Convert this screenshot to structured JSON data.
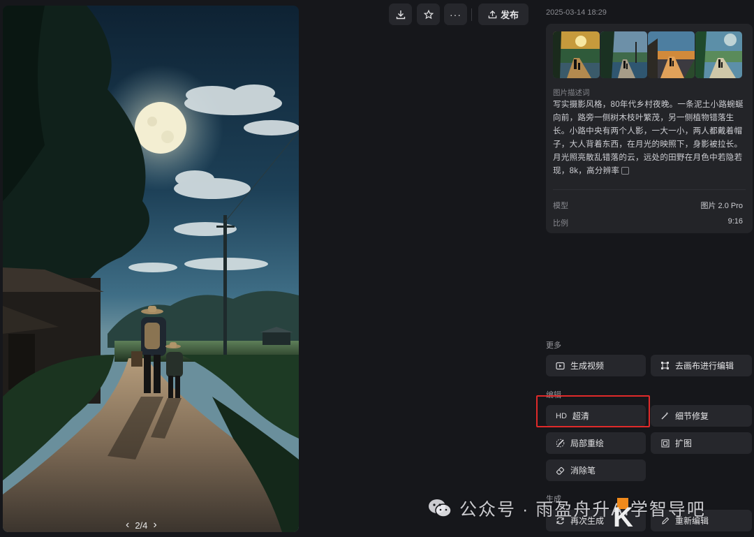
{
  "viewer": {
    "pager": {
      "current": "2/4"
    }
  },
  "toolbar": {
    "publish_label": "发布"
  },
  "detail": {
    "timestamp": "2025-03-14 18:29",
    "prompt_label": "图片描述词",
    "prompt_text": "写实摄影风格，80年代乡村夜晚。一条泥土小路蜿蜒向前，路旁一侧树木枝叶繁茂，另一侧植物错落生长。小路中央有两个人影，一大一小，两人都戴着帽子，大人背着东西，在月光的映照下，身影被拉长。月光照亮散乱错落的云，远处的田野在月色中若隐若现，8k，高分辨率",
    "model_label": "模型",
    "model_value": "图片 2.0 Pro",
    "ratio_label": "比例",
    "ratio_value": "9:16"
  },
  "more": {
    "title": "更多",
    "generate_video": "生成视频",
    "canvas_edit": "去画布进行编辑"
  },
  "edit": {
    "title": "编辑",
    "hd_badge": "HD",
    "upscale": "超清",
    "detail_fix": "细节修复",
    "inpaint": "局部重绘",
    "outpaint": "扩图",
    "eraser": "消除笔"
  },
  "generate": {
    "title": "生成",
    "regenerate": "再次生成",
    "reedit": "重新编辑"
  },
  "watermark": {
    "text": "公众号 · 雨盈舟升AI学智导吧",
    "corner_logo_text": "K"
  },
  "colors": {
    "background": "#16171b",
    "panel": "#232428",
    "button": "#26272c",
    "highlight": "#e02a2a"
  }
}
